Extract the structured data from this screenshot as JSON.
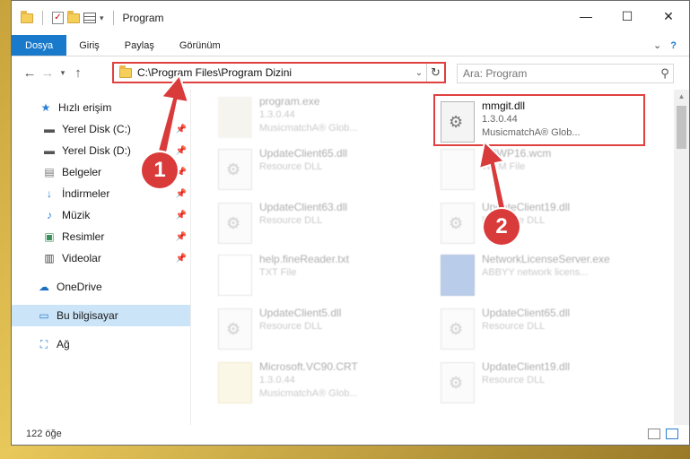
{
  "window": {
    "title": "Program",
    "controls": {
      "minimize": "—",
      "maximize": "☐",
      "close": "✕"
    }
  },
  "ribbon": {
    "tabs": [
      "Dosya",
      "Giriş",
      "Paylaş",
      "Görünüm"
    ]
  },
  "address_bar": {
    "path": "C:\\Program Files\\Program Dizini"
  },
  "search": {
    "placeholder": "Ara: Program"
  },
  "nav_pane": {
    "quick_access": "Hızlı erişim",
    "items": [
      {
        "label": "Yerel Disk (C:)",
        "icon": "drive-icon"
      },
      {
        "label": "Yerel Disk (D:)",
        "icon": "drive-icon"
      },
      {
        "label": "Belgeler",
        "icon": "documents-icon"
      },
      {
        "label": "İndirmeler",
        "icon": "download-icon"
      },
      {
        "label": "Müzik",
        "icon": "music-icon"
      },
      {
        "label": "Resimler",
        "icon": "pictures-icon"
      },
      {
        "label": "Videolar",
        "icon": "video-icon"
      }
    ],
    "onedrive": "OneDrive",
    "this_pc": "Bu bilgisayar",
    "network": "Ağ"
  },
  "files": {
    "highlighted": {
      "name": "mmgit.dll",
      "version": "1.3.0.44",
      "company": "MusicmatchA® Glob..."
    },
    "others": [
      {
        "name": "program.exe",
        "line1": "1.3.0.44",
        "line2": "MusicmatchA® Glob..."
      },
      {
        "name": "UpdateClient65.dll",
        "line1": "Resource DLL",
        "line2": ""
      },
      {
        "name": "rc3WP16.wcm",
        "line1": "WCM File",
        "line2": ""
      },
      {
        "name": "UpdateClient63.dll",
        "line1": "Resource DLL",
        "line2": ""
      },
      {
        "name": "UpdateClient19.dll",
        "line1": "Resource DLL",
        "line2": ""
      },
      {
        "name": "help.fineReader.txt",
        "line1": "TXT File",
        "line2": ""
      },
      {
        "name": "NetworkLicenseServer.exe",
        "line1": "ABBYY network licens...",
        "line2": ""
      },
      {
        "name": "UpdateClient5.dll",
        "line1": "Resource DLL",
        "line2": ""
      },
      {
        "name": "UpdateClient65.dll",
        "line1": "Resource DLL",
        "line2": ""
      },
      {
        "name": "Microsoft.VC90.CRT",
        "line1": "1.3.0.44",
        "line2": "MusicmatchA® Glob..."
      },
      {
        "name": "UpdateClient19.dll",
        "line1": "Resource DLL",
        "line2": ""
      }
    ]
  },
  "status": {
    "count": "122 öğe"
  },
  "callouts": [
    "1",
    "2"
  ],
  "colors": {
    "accent": "#1979ca",
    "highlight": "#e04040",
    "selected": "#cce4f7"
  }
}
